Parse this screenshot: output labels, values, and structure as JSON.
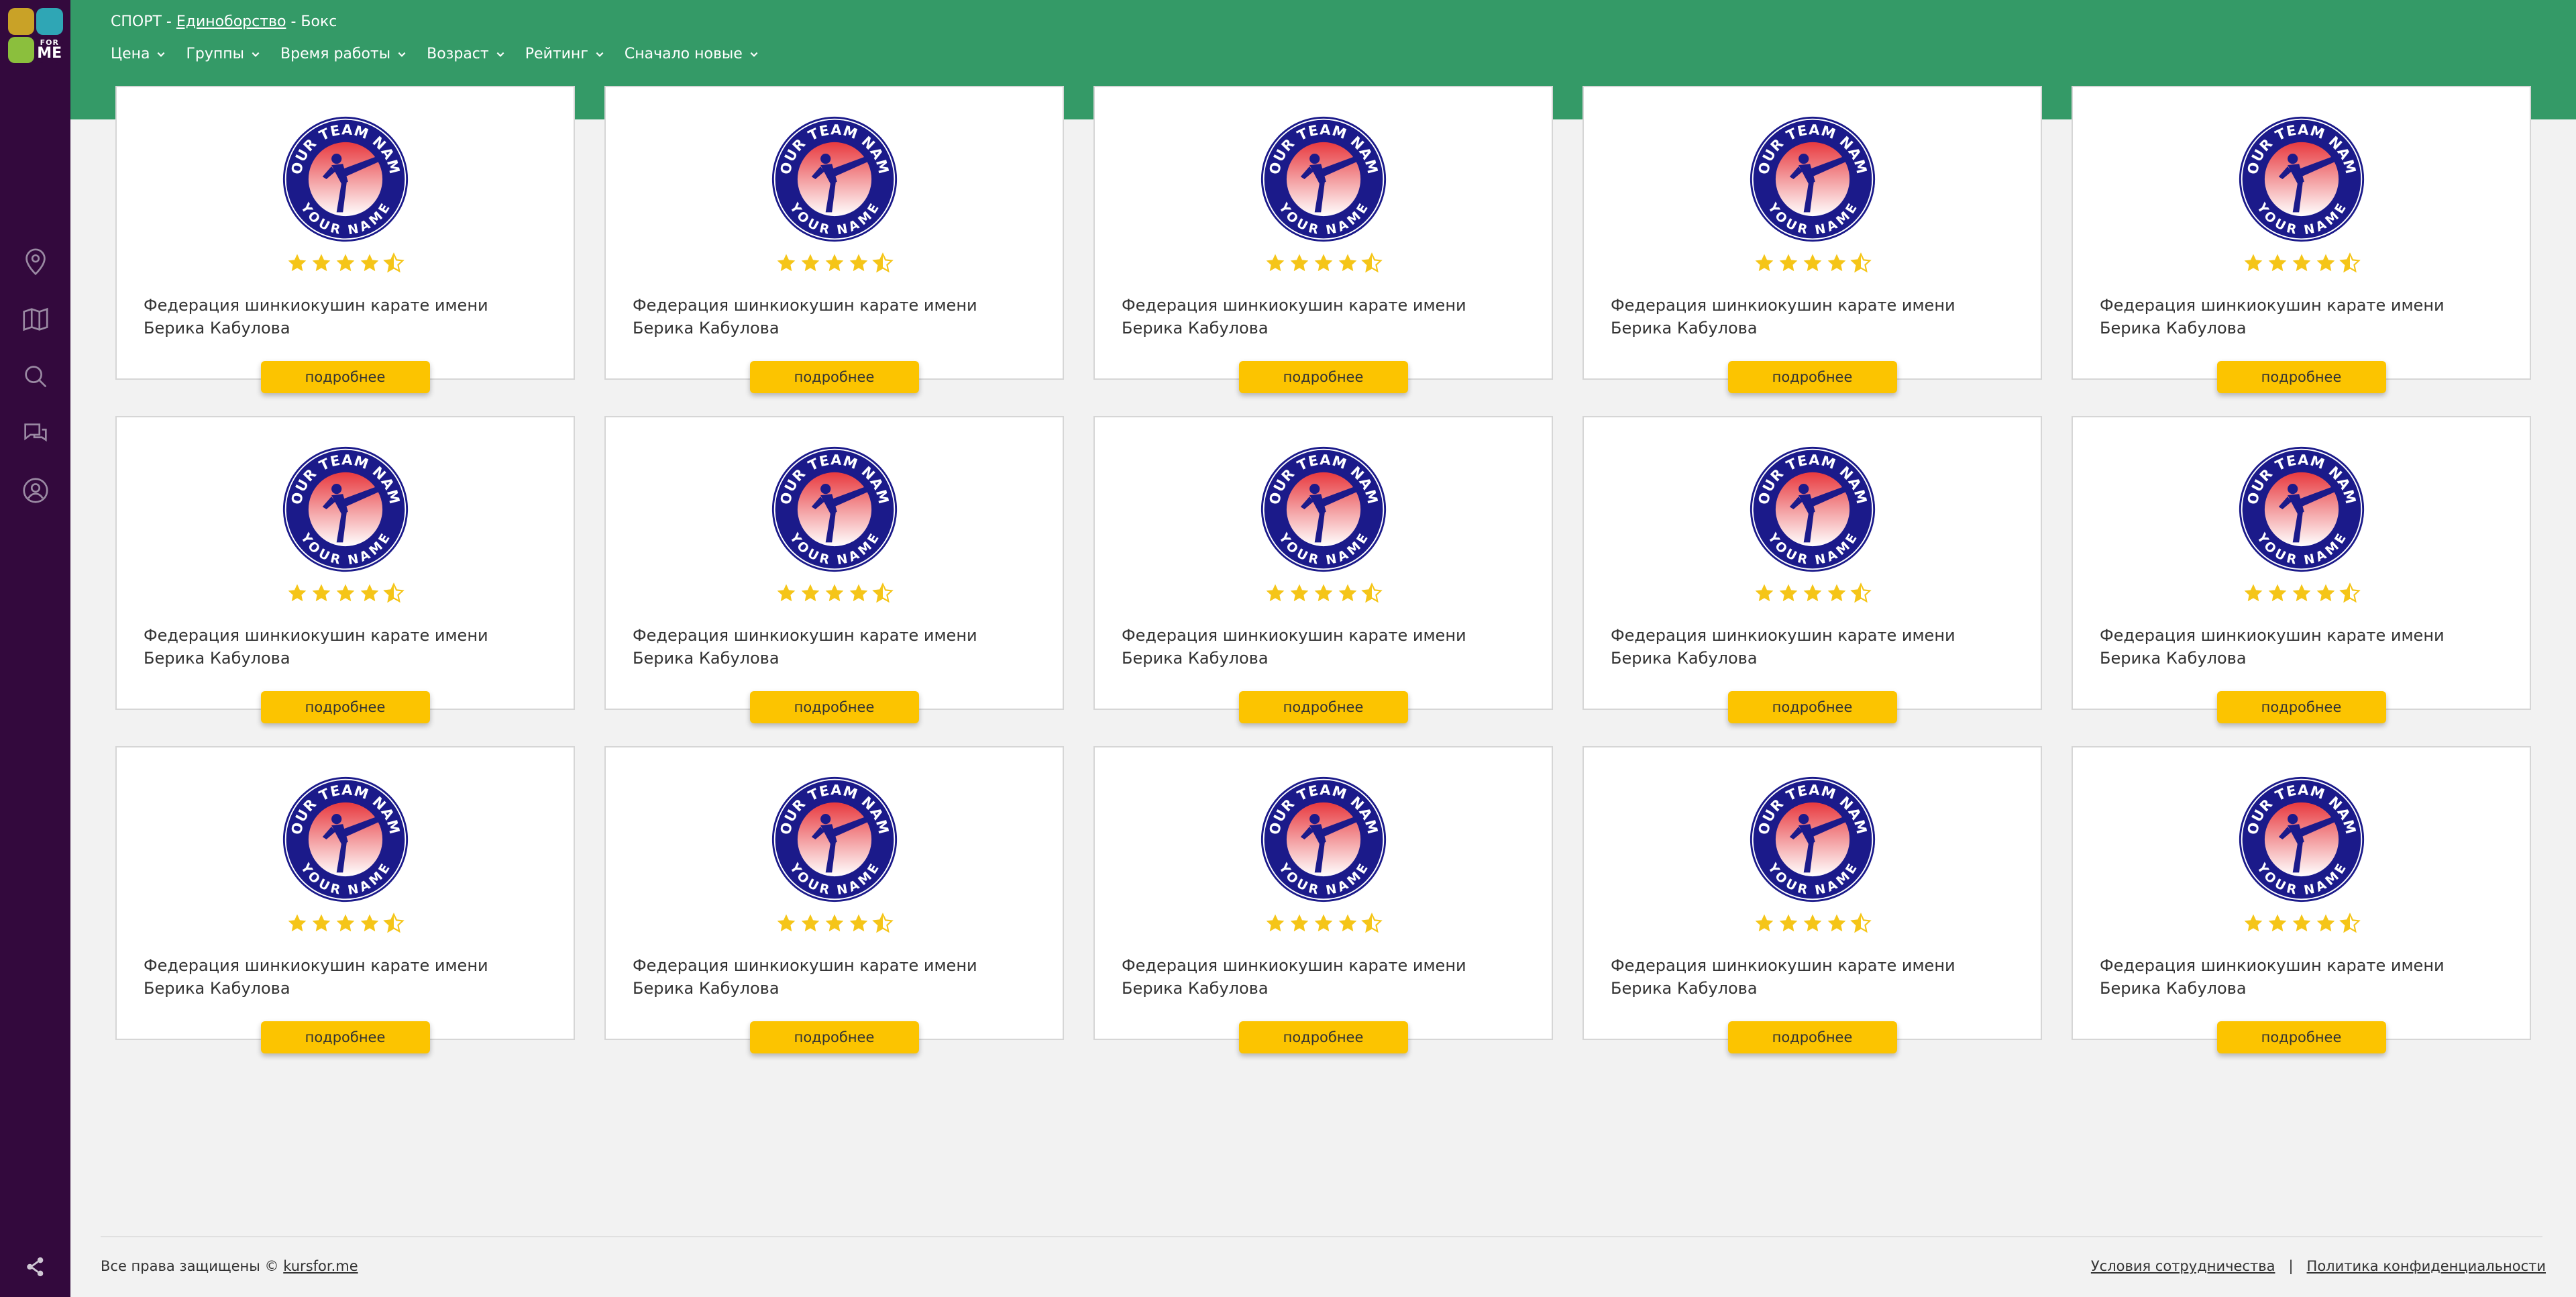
{
  "logo": {
    "line1": "FOR",
    "line2": "ME"
  },
  "breadcrumb": {
    "root": "СПОРТ",
    "separator": " - ",
    "category": "Единоборство",
    "current": "Бокс"
  },
  "filters": [
    {
      "label": "Цена"
    },
    {
      "label": "Группы"
    },
    {
      "label": "Время работы"
    },
    {
      "label": "Возраст"
    },
    {
      "label": "Рейтинг"
    },
    {
      "label": "Сначало новые"
    }
  ],
  "sidebar": {
    "icons": [
      "location-icon",
      "map-icon",
      "search-icon",
      "chat-icon",
      "user-icon"
    ],
    "bottom_icon": "share-icon"
  },
  "cards": [
    {
      "title": "Федерация шинкиокушин карате имени Берика Кабулова",
      "rating": 4.5,
      "button": "подробнее"
    },
    {
      "title": "Федерация шинкиокушин карате имени Берика Кабулова",
      "rating": 4.5,
      "button": "подробнее"
    },
    {
      "title": "Федерация шинкиокушин карате имени Берика Кабулова",
      "rating": 4.5,
      "button": "подробнее"
    },
    {
      "title": "Федерация шинкиокушин карате имени Берика Кабулова",
      "rating": 4.5,
      "button": "подробнее"
    },
    {
      "title": "Федерация шинкиокушин карате имени Берика Кабулова",
      "rating": 4.5,
      "button": "подробнее"
    },
    {
      "title": "Федерация шинкиокушин карате имени Берика Кабулова",
      "rating": 4.5,
      "button": "подробнее"
    },
    {
      "title": "Федерация шинкиокушин карате имени Берика Кабулова",
      "rating": 4.5,
      "button": "подробнее"
    },
    {
      "title": "Федерация шинкиокушин карате имени Берика Кабулова",
      "rating": 4.5,
      "button": "подробнее"
    },
    {
      "title": "Федерация шинкиокушин карате имени Берика Кабулова",
      "rating": 4.5,
      "button": "подробнее"
    },
    {
      "title": "Федерация шинкиокушин карате имени Берика Кабулова",
      "rating": 4.5,
      "button": "подробнее"
    },
    {
      "title": "Федерация шинкиокушин карате имени Берика Кабулова",
      "rating": 4.5,
      "button": "подробнее"
    },
    {
      "title": "Федерация шинкиокушин карате имени Берика Кабулова",
      "rating": 4.5,
      "button": "подробнее"
    },
    {
      "title": "Федерация шинкиокушин карате имени Берика Кабулова",
      "rating": 4.5,
      "button": "подробнее"
    },
    {
      "title": "Федерация шинкиокушин карате имени Берика Кабулова",
      "rating": 4.5,
      "button": "подробнее"
    },
    {
      "title": "Федерация шинкиокушин карате имени Берика Кабулова",
      "rating": 4.5,
      "button": "подробнее"
    }
  ],
  "emblem": {
    "top_text": "YOUR TEAM NAME",
    "bottom_text": "YOUR NAME"
  },
  "footer": {
    "copyright": "Все права защищены © ",
    "site": "kursfor.me",
    "terms": "Условия сотрудничества",
    "divider": "|",
    "privacy": "Политика конфиденциальности"
  },
  "colors": {
    "sidebar": "#33093d",
    "header": "#349a67",
    "button": "#fcc400",
    "star": "#f5c518",
    "emblem_navy": "#1b1a8a"
  }
}
